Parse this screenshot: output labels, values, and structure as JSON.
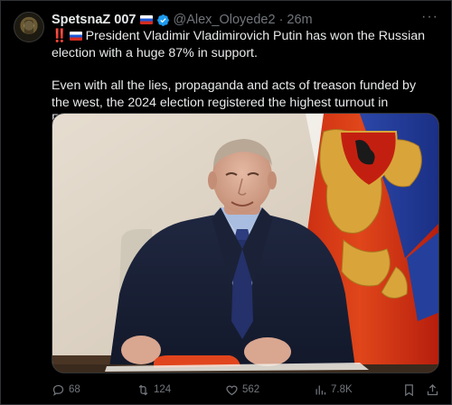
{
  "author": {
    "display_name": "SpetsnaZ 007",
    "handle": "@Alex_Oloyede2",
    "separator": "·",
    "time": "26m"
  },
  "tweet": {
    "exclamation": "‼️",
    "paragraph1": "President Vladimir Vladimirovich Putin has won the Russian election with a huge 87% in support.",
    "paragraph2": "Even with all the lies, propaganda and acts of treason funded by the west, the 2024 election registered the highest turnout in Russian history."
  },
  "actions": {
    "replies": "68",
    "reposts": "124",
    "likes": "562",
    "views": "7.8K"
  },
  "colors": {
    "background": "#000000",
    "text": "#e7e9ea",
    "muted": "#71767b",
    "verified": "#1d9bf0",
    "flag_red": "#d52b1e",
    "flag_blue": "#1c57d6"
  },
  "icons": [
    "verified-badge-icon",
    "russian-flag-icon",
    "more-icon",
    "reply-icon",
    "repost-icon",
    "like-icon",
    "views-icon",
    "bookmark-icon",
    "share-icon"
  ]
}
